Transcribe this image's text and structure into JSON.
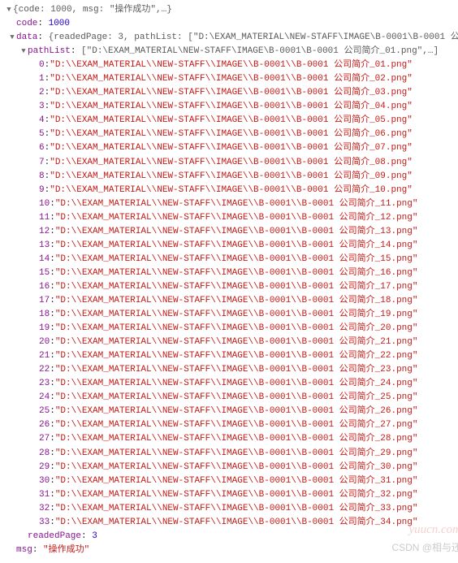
{
  "root_summary": "{code: 1000, msg: \"操作成功\",…}",
  "code_key": "code",
  "code_value": 1000,
  "data_key": "data",
  "data_summary": "{readedPage: 3, pathList: [\"D:\\EXAM_MATERIAL\\NEW-STAFF\\IMAGE\\B-0001\\B-0001 公",
  "pathlist_key": "pathList",
  "pathlist_summary": "[\"D:\\EXAM_MATERIAL\\NEW-STAFF\\IMAGE\\B-0001\\B-0001 公司简介_01.png\",…]",
  "pathlist_items": [
    "\"D:\\\\EXAM_MATERIAL\\\\NEW-STAFF\\\\IMAGE\\\\B-0001\\\\B-0001 公司简介_01.png\"",
    "\"D:\\\\EXAM_MATERIAL\\\\NEW-STAFF\\\\IMAGE\\\\B-0001\\\\B-0001 公司简介_02.png\"",
    "\"D:\\\\EXAM_MATERIAL\\\\NEW-STAFF\\\\IMAGE\\\\B-0001\\\\B-0001 公司简介_03.png\"",
    "\"D:\\\\EXAM_MATERIAL\\\\NEW-STAFF\\\\IMAGE\\\\B-0001\\\\B-0001 公司简介_04.png\"",
    "\"D:\\\\EXAM_MATERIAL\\\\NEW-STAFF\\\\IMAGE\\\\B-0001\\\\B-0001 公司简介_05.png\"",
    "\"D:\\\\EXAM_MATERIAL\\\\NEW-STAFF\\\\IMAGE\\\\B-0001\\\\B-0001 公司简介_06.png\"",
    "\"D:\\\\EXAM_MATERIAL\\\\NEW-STAFF\\\\IMAGE\\\\B-0001\\\\B-0001 公司简介_07.png\"",
    "\"D:\\\\EXAM_MATERIAL\\\\NEW-STAFF\\\\IMAGE\\\\B-0001\\\\B-0001 公司简介_08.png\"",
    "\"D:\\\\EXAM_MATERIAL\\\\NEW-STAFF\\\\IMAGE\\\\B-0001\\\\B-0001 公司简介_09.png\"",
    "\"D:\\\\EXAM_MATERIAL\\\\NEW-STAFF\\\\IMAGE\\\\B-0001\\\\B-0001 公司简介_10.png\"",
    "\"D:\\\\EXAM_MATERIAL\\\\NEW-STAFF\\\\IMAGE\\\\B-0001\\\\B-0001 公司简介_11.png\"",
    "\"D:\\\\EXAM_MATERIAL\\\\NEW-STAFF\\\\IMAGE\\\\B-0001\\\\B-0001 公司简介_12.png\"",
    "\"D:\\\\EXAM_MATERIAL\\\\NEW-STAFF\\\\IMAGE\\\\B-0001\\\\B-0001 公司简介_13.png\"",
    "\"D:\\\\EXAM_MATERIAL\\\\NEW-STAFF\\\\IMAGE\\\\B-0001\\\\B-0001 公司简介_14.png\"",
    "\"D:\\\\EXAM_MATERIAL\\\\NEW-STAFF\\\\IMAGE\\\\B-0001\\\\B-0001 公司简介_15.png\"",
    "\"D:\\\\EXAM_MATERIAL\\\\NEW-STAFF\\\\IMAGE\\\\B-0001\\\\B-0001 公司简介_16.png\"",
    "\"D:\\\\EXAM_MATERIAL\\\\NEW-STAFF\\\\IMAGE\\\\B-0001\\\\B-0001 公司简介_17.png\"",
    "\"D:\\\\EXAM_MATERIAL\\\\NEW-STAFF\\\\IMAGE\\\\B-0001\\\\B-0001 公司简介_18.png\"",
    "\"D:\\\\EXAM_MATERIAL\\\\NEW-STAFF\\\\IMAGE\\\\B-0001\\\\B-0001 公司简介_19.png\"",
    "\"D:\\\\EXAM_MATERIAL\\\\NEW-STAFF\\\\IMAGE\\\\B-0001\\\\B-0001 公司简介_20.png\"",
    "\"D:\\\\EXAM_MATERIAL\\\\NEW-STAFF\\\\IMAGE\\\\B-0001\\\\B-0001 公司简介_21.png\"",
    "\"D:\\\\EXAM_MATERIAL\\\\NEW-STAFF\\\\IMAGE\\\\B-0001\\\\B-0001 公司简介_22.png\"",
    "\"D:\\\\EXAM_MATERIAL\\\\NEW-STAFF\\\\IMAGE\\\\B-0001\\\\B-0001 公司简介_23.png\"",
    "\"D:\\\\EXAM_MATERIAL\\\\NEW-STAFF\\\\IMAGE\\\\B-0001\\\\B-0001 公司简介_24.png\"",
    "\"D:\\\\EXAM_MATERIAL\\\\NEW-STAFF\\\\IMAGE\\\\B-0001\\\\B-0001 公司简介_25.png\"",
    "\"D:\\\\EXAM_MATERIAL\\\\NEW-STAFF\\\\IMAGE\\\\B-0001\\\\B-0001 公司简介_26.png\"",
    "\"D:\\\\EXAM_MATERIAL\\\\NEW-STAFF\\\\IMAGE\\\\B-0001\\\\B-0001 公司简介_27.png\"",
    "\"D:\\\\EXAM_MATERIAL\\\\NEW-STAFF\\\\IMAGE\\\\B-0001\\\\B-0001 公司简介_28.png\"",
    "\"D:\\\\EXAM_MATERIAL\\\\NEW-STAFF\\\\IMAGE\\\\B-0001\\\\B-0001 公司简介_29.png\"",
    "\"D:\\\\EXAM_MATERIAL\\\\NEW-STAFF\\\\IMAGE\\\\B-0001\\\\B-0001 公司简介_30.png\"",
    "\"D:\\\\EXAM_MATERIAL\\\\NEW-STAFF\\\\IMAGE\\\\B-0001\\\\B-0001 公司简介_31.png\"",
    "\"D:\\\\EXAM_MATERIAL\\\\NEW-STAFF\\\\IMAGE\\\\B-0001\\\\B-0001 公司简介_32.png\"",
    "\"D:\\\\EXAM_MATERIAL\\\\NEW-STAFF\\\\IMAGE\\\\B-0001\\\\B-0001 公司简介_33.png\"",
    "\"D:\\\\EXAM_MATERIAL\\\\NEW-STAFF\\\\IMAGE\\\\B-0001\\\\B-0001 公司简介_34.png\""
  ],
  "readedpage_key": "readedPage",
  "readedpage_value": 3,
  "msg_key": "msg",
  "msg_value": "\"操作成功\"",
  "watermark1": "yuucn.com",
  "watermark2": "CSDN @相与还"
}
